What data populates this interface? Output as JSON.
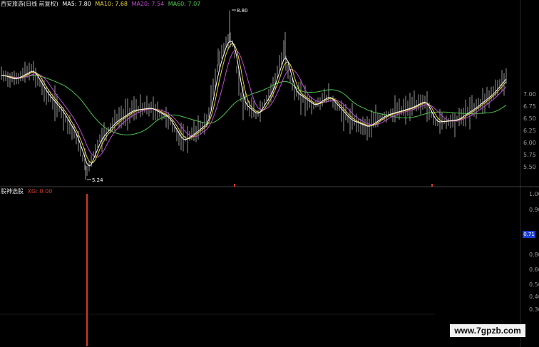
{
  "main_legend": {
    "title": "西安旅游(日线 前复权)",
    "ma5": "MA5: 7.80",
    "ma10": "MA10: 7.68",
    "ma20": "MA20: 7.54",
    "ma60": "MA60: 7.07"
  },
  "sub_legend": {
    "title": "股神选股",
    "value": "XG: 0.00"
  },
  "colors": {
    "background": "#000000",
    "candle": "#d8d8d8",
    "ma5": "#ffffff",
    "ma10": "#e8d23a",
    "ma20": "#c04ad0",
    "ma60": "#4bc24b",
    "signal": "#d03a2a",
    "axis_text": "#9a9a9a"
  },
  "annotations": {
    "high": "8.80",
    "low": "5.24"
  },
  "main_axis": [
    "7.00",
    "6.75",
    "6.50",
    "6.25",
    "6.00",
    "5.75",
    "5.50"
  ],
  "sub_axis": [
    "1.00",
    "0.90",
    "0.80",
    "0.60",
    "0.50",
    "0.40",
    "0.30"
  ],
  "sub_marker": "0.71",
  "watermark": "www.7gpzb.com",
  "chart_data": {
    "type": "line",
    "title": "西安旅游(日线 前复权)",
    "xlabel": "",
    "ylabel": "",
    "ylim": [
      5.2,
      8.9
    ],
    "price_high": 8.8,
    "price_low": 5.24,
    "series": [
      {
        "name": "MA5",
        "last": 7.8
      },
      {
        "name": "MA10",
        "last": 7.68
      },
      {
        "name": "MA20",
        "last": 7.54
      },
      {
        "name": "MA60",
        "last": 7.07
      }
    ],
    "indicator": {
      "name": "XG",
      "last": 0.0,
      "ylim": [
        0,
        1
      ],
      "signal_values": [
        1.0
      ]
    }
  }
}
